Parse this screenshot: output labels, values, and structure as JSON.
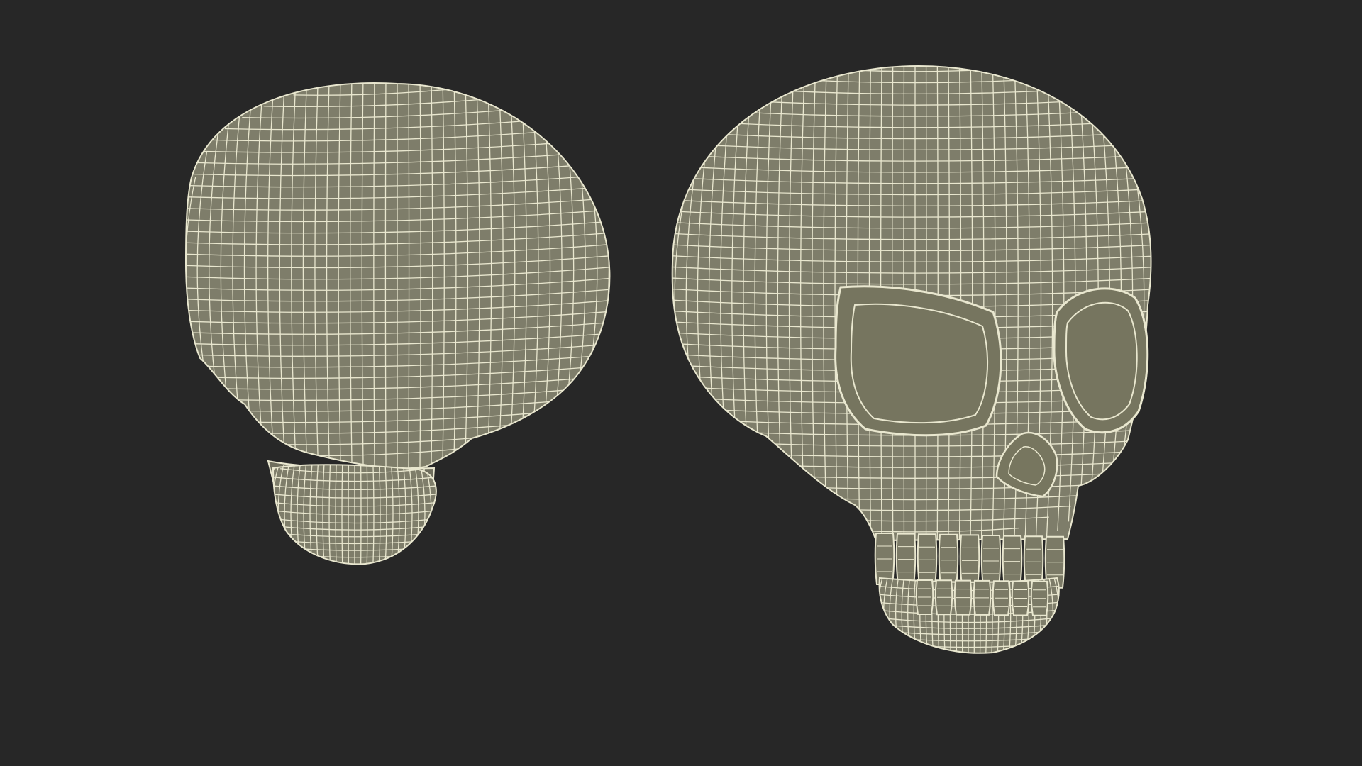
{
  "scene": {
    "background_color": "#272727",
    "mesh_fill_color": "#7e7d6a",
    "wire_color": "#e9e7cf",
    "objects": [
      {
        "name": "skull-side-view",
        "icon": "skull-icon"
      },
      {
        "name": "skull-front-view",
        "icon": "skull-icon"
      }
    ]
  }
}
